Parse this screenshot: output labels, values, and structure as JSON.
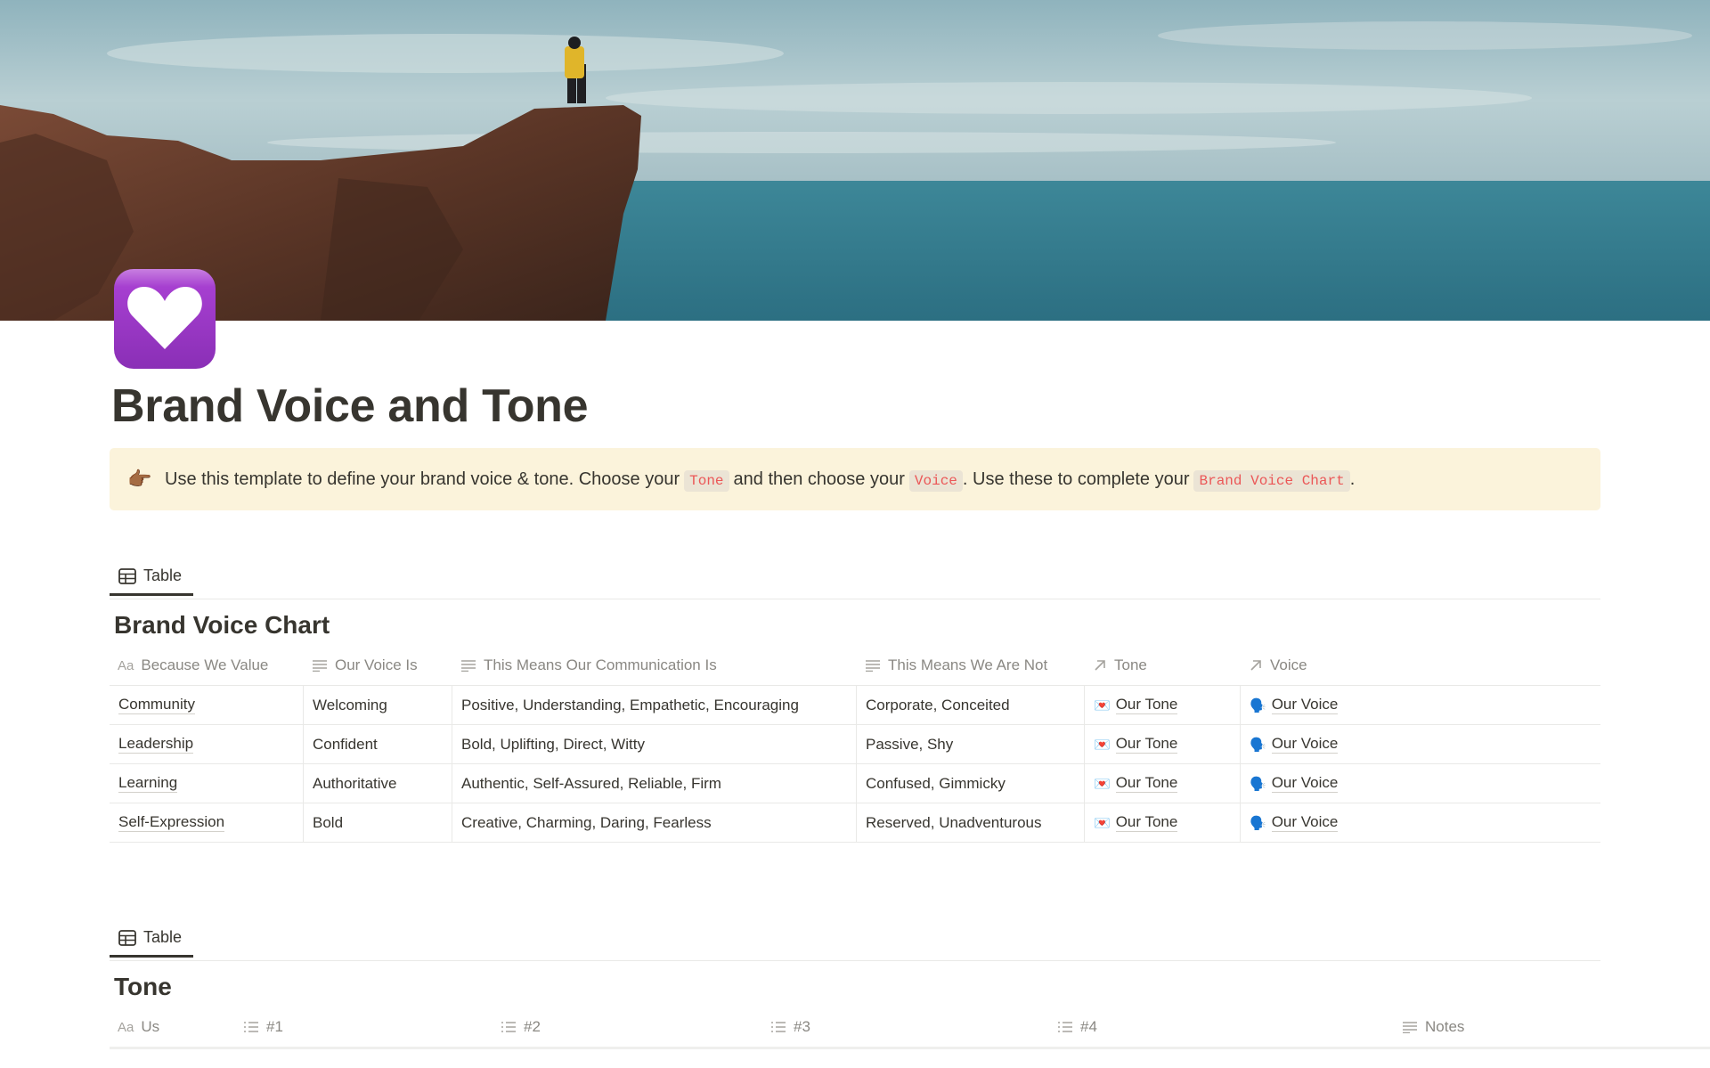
{
  "page": {
    "title": "Brand Voice and Tone",
    "icon": "white-heart-purple-square-icon",
    "cover": "cliff-over-sea-photo"
  },
  "callout": {
    "icon": "pointing-hand-icon",
    "emoji": "👉🏾",
    "text_1": "Use this template to define your brand voice & tone. Choose your",
    "code_1": "Tone",
    "text_2": "and then choose your",
    "code_2": "Voice",
    "text_3": ". Use these to complete your",
    "code_3": "Brand Voice Chart",
    "text_4": "."
  },
  "brand_voice_chart": {
    "view_tab": "Table",
    "title": "Brand Voice Chart",
    "columns": [
      {
        "label": "Because We Value",
        "icon": "title-aa-icon"
      },
      {
        "label": "Our Voice Is",
        "icon": "text-lines-icon"
      },
      {
        "label": "This Means Our Communication Is",
        "icon": "text-lines-icon"
      },
      {
        "label": "This Means We Are Not",
        "icon": "text-lines-icon"
      },
      {
        "label": "Tone",
        "icon": "relation-arrow-icon"
      },
      {
        "label": "Voice",
        "icon": "relation-arrow-icon"
      }
    ],
    "rows": [
      {
        "value": "Community",
        "voice": "Welcoming",
        "means": "Positive, Understanding, Empathetic, Encouraging",
        "not": "Corporate, Conceited",
        "tone": "Our Tone",
        "voice_rel": "Our Voice"
      },
      {
        "value": "Leadership",
        "voice": "Confident",
        "means": "Bold, Uplifting, Direct, Witty",
        "not": "Passive, Shy",
        "tone": "Our Tone",
        "voice_rel": "Our Voice"
      },
      {
        "value": "Learning",
        "voice": "Authoritative",
        "means": "Authentic, Self-Assured, Reliable, Firm",
        "not": "Confused, Gimmicky",
        "tone": "Our Tone",
        "voice_rel": "Our Voice"
      },
      {
        "value": "Self-Expression",
        "voice": "Bold",
        "means": "Creative, Charming, Daring, Fearless",
        "not": "Reserved, Unadventurous",
        "tone": "Our Tone",
        "voice_rel": "Our Voice"
      }
    ],
    "tone_emoji": "💌",
    "voice_emoji": "🗣️"
  },
  "tone_table": {
    "view_tab": "Table",
    "title": "Tone",
    "columns": [
      {
        "label": "Us",
        "icon": "title-aa-icon"
      },
      {
        "label": "#1",
        "icon": "multi-select-list-icon"
      },
      {
        "label": "#2",
        "icon": "multi-select-list-icon"
      },
      {
        "label": "#3",
        "icon": "multi-select-list-icon"
      },
      {
        "label": "#4",
        "icon": "multi-select-list-icon"
      },
      {
        "label": "Notes",
        "icon": "text-lines-icon"
      }
    ]
  },
  "colors": {
    "text": "#37352f",
    "muted": "#8a8883",
    "callout_bg": "#fbf3db",
    "code_text": "#eb5757",
    "code_bg": "#ebe4d5",
    "border": "#e9e9e7",
    "icon_purple": "#9b3dc4"
  }
}
